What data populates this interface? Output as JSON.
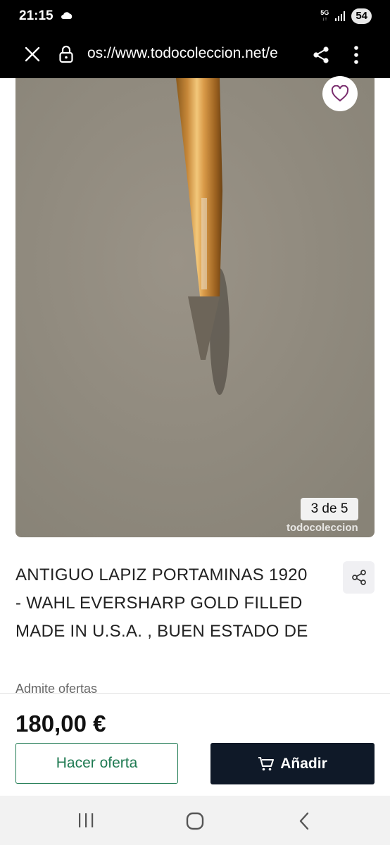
{
  "status": {
    "time": "21:15",
    "network": "5G",
    "battery": "54",
    "icons": [
      "cloud-icon",
      "signal-icon",
      "battery-icon"
    ]
  },
  "browser": {
    "url": "os://www.todocoleccion.net/e",
    "icons": [
      "close-icon",
      "lock-icon",
      "share-icon",
      "more-icon"
    ]
  },
  "product": {
    "image_counter": "3 de 5",
    "watermark": "todocoleccion",
    "title": "ANTIGUO LAPIZ PORTAMINAS 1920 - WAHL EVERSHARP GOLD FILLED MADE IN U.S.A. , BUEN ESTADO DE",
    "admite": "Admite ofertas",
    "price": "180,00 €"
  },
  "actions": {
    "offer_label": "Hacer oferta",
    "add_label": "Añadir"
  },
  "nav": {
    "icons": [
      "recents-icon",
      "home-icon",
      "back-icon"
    ]
  },
  "colors": {
    "accent_green": "#1f7a52",
    "dark_button": "#0f1928",
    "favorite_heart": "#7a2d6e"
  }
}
